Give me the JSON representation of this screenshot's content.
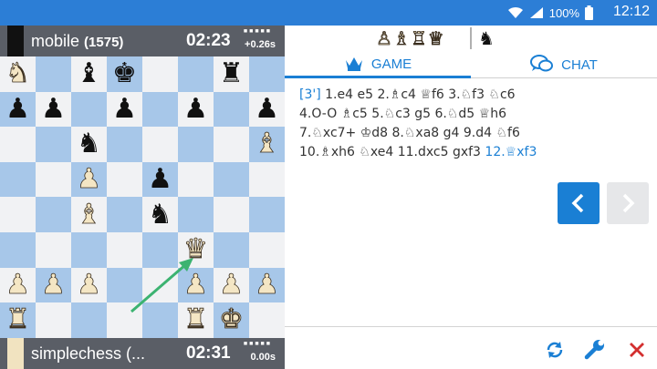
{
  "status_bar": {
    "battery": "100%",
    "clock": "12:12",
    "icons": [
      "wifi-icon",
      "signal-icon",
      "battery-icon"
    ]
  },
  "top_player": {
    "name": "mobile",
    "rating": "(1575)",
    "time": "02:23",
    "increment": "+0.26s",
    "color": "black"
  },
  "bottom_player": {
    "name": "simplechess (...",
    "time": "02:31",
    "increment": "0.00s",
    "color": "white"
  },
  "captured": {
    "white": "♙♗♖♕",
    "black": "♞"
  },
  "tabs": {
    "game": "GAME",
    "chat": "CHAT"
  },
  "moves": {
    "eco": "[3']",
    "lines": [
      "1.e4 e5 2.♗c4 ♕f6 3.♘f3 ♘c6",
      "4.O-O ♗c5 5.♘c3 g5 6.♘d5 ♕h6",
      "7.♘xc7+ ♔d8 8.♘xa8 g4 9.d4 ♘f6",
      "10.♗xh6 ♘xe4 11.dxc5 gxf3"
    ],
    "current": "12.♕xf3"
  },
  "board": [
    [
      "wN",
      "",
      "bB",
      "bK",
      "",
      "",
      "bR",
      ""
    ],
    [
      "bP",
      "bP",
      "",
      "bP",
      "",
      "bP",
      "",
      "bP"
    ],
    [
      "",
      "",
      "bN",
      "",
      "",
      "",
      "",
      "wB"
    ],
    [
      "",
      "",
      "wP",
      "",
      "bP",
      "",
      "",
      ""
    ],
    [
      "",
      "",
      "wB",
      "",
      "bN",
      "",
      "",
      ""
    ],
    [
      "",
      "",
      "",
      "",
      "",
      "wQ",
      "",
      ""
    ],
    [
      "wP",
      "wP",
      "wP",
      "",
      "",
      "wP",
      "wP",
      "wP"
    ],
    [
      "wR",
      "",
      "",
      "",
      "",
      "wR",
      "wK",
      ""
    ]
  ],
  "colors": {
    "accent": "#1a7fd4",
    "status_bar": "#2c7ed6",
    "player_bar": "#5a5e66",
    "dark_square": "#a7c7e9",
    "light_square": "#f1f2f4",
    "arrow": "#3cb371",
    "close_red": "#d32f2f"
  }
}
